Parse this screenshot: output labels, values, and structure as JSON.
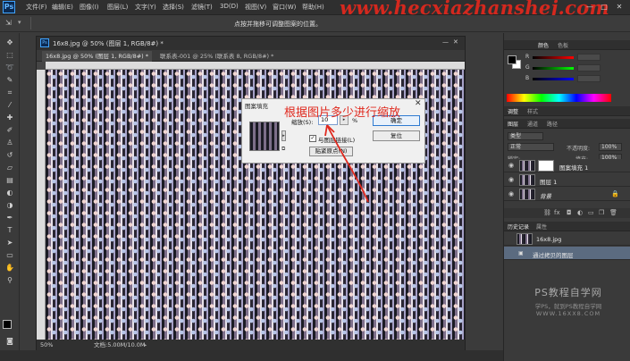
{
  "app": {
    "logo": "Ps",
    "menu": [
      "文件(F)",
      "编辑(E)",
      "图像(I)",
      "图层(L)",
      "文字(Y)",
      "选择(S)",
      "滤镜(T)",
      "3D(D)",
      "视图(V)",
      "窗口(W)",
      "帮助(H)"
    ],
    "watermark_url": "www.hecxiazhanshej.com",
    "window_controls": [
      "—",
      "□",
      "✕"
    ]
  },
  "options_bar": {
    "hint": "点按并拖移可调整图案的位置。"
  },
  "document": {
    "title": "16x8.jpg @ 50% (图层 1, RGB/8#) *",
    "tabs": [
      {
        "label": "16x8.jpg @ 50% (图层 1, RGB/8#) *"
      },
      {
        "label": "联系表-001 @ 25% (联系表 8, RGB/8#) *"
      }
    ],
    "zoom": "50%",
    "doc_info": "文档:5.00M/10.0M"
  },
  "dialog": {
    "title": "图案填充",
    "scale_label": "缩放(S):",
    "scale_value": "10",
    "scale_unit": "%",
    "ok": "确定",
    "reset": "复位",
    "align_label": "与图层链接(L)",
    "align_checked": true,
    "snap_button": "贴紧原点(N)",
    "close": "✕"
  },
  "annotation": {
    "text": "根据图片多少进行缩放",
    "color": "#e0291e"
  },
  "panels": {
    "color_tabs": [
      "颜色",
      "色板"
    ],
    "adjust_tabs": [
      "调整",
      "样式"
    ],
    "layers_tabs": [
      "图层",
      "通道",
      "路径"
    ],
    "blend_mode": "正常",
    "opacity_label": "不透明度:",
    "opacity_value": "100%",
    "lock_label": "锁定:",
    "fill_label": "填充:",
    "fill_value": "100%",
    "kind_label": "类型",
    "layers": [
      {
        "name": "图案填充 1",
        "selected": false,
        "has_mask": true
      },
      {
        "name": "图层 1",
        "selected": false,
        "has_mask": false
      },
      {
        "name": "背景",
        "selected": false,
        "has_mask": false
      }
    ],
    "history_tabs": [
      "历史记录",
      "属性"
    ],
    "history": [
      {
        "name": "16x8.jpg",
        "selected": false
      },
      {
        "name": "通过拷贝的图层",
        "selected": true
      }
    ]
  },
  "bottom_watermark": {
    "title": "PS教程自学网",
    "subtitle": "学PS，就到PS教程自学网",
    "url": "WWW.16XX8.COM"
  }
}
